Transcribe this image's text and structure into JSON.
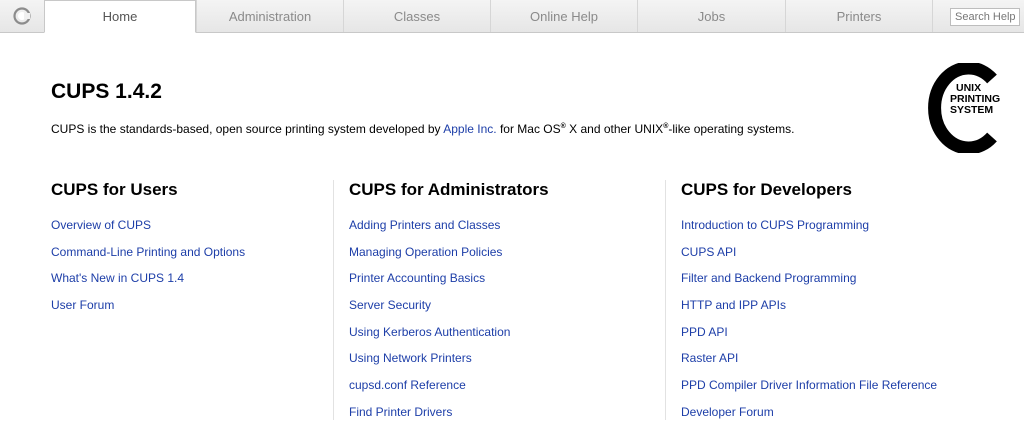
{
  "nav": {
    "logo_icon": "cups-logo-icon",
    "tabs": [
      {
        "label": "Home",
        "active": true
      },
      {
        "label": "Administration",
        "active": false
      },
      {
        "label": "Classes",
        "active": false
      },
      {
        "label": "Online Help",
        "active": false
      },
      {
        "label": "Jobs",
        "active": false
      },
      {
        "label": "Printers",
        "active": false
      }
    ],
    "search_placeholder": "Search Help"
  },
  "header": {
    "title": "CUPS 1.4.2",
    "intro_before": "CUPS is the standards-based, open source printing system developed by ",
    "intro_link": "Apple Inc.",
    "intro_mid": " for Mac OS",
    "intro_reg": "®",
    "intro_mid2": " X and other UNIX",
    "intro_reg2": "®",
    "intro_after": "-like operating systems."
  },
  "unix_logo": {
    "line1": "UNIX",
    "line2": "PRINTING",
    "line3": "SYSTEM"
  },
  "sections": {
    "users": {
      "title": "CUPS for Users",
      "links": [
        "Overview of CUPS",
        "Command-Line Printing and Options",
        "What's New in CUPS 1.4",
        "User Forum"
      ]
    },
    "admin": {
      "title": "CUPS for Administrators",
      "links": [
        "Adding Printers and Classes",
        "Managing Operation Policies",
        "Printer Accounting Basics",
        "Server Security",
        "Using Kerberos Authentication",
        "Using Network Printers",
        "cupsd.conf Reference",
        "Find Printer Drivers"
      ]
    },
    "dev": {
      "title": "CUPS for Developers",
      "links": [
        "Introduction to CUPS Programming",
        "CUPS API",
        "Filter and Backend Programming",
        "HTTP and IPP APIs",
        "PPD API",
        "Raster API",
        "PPD Compiler Driver Information File Reference",
        "Developer Forum"
      ]
    }
  },
  "colors": {
    "link": "#1d3ea8",
    "nav_text": "#8a8a8a"
  }
}
